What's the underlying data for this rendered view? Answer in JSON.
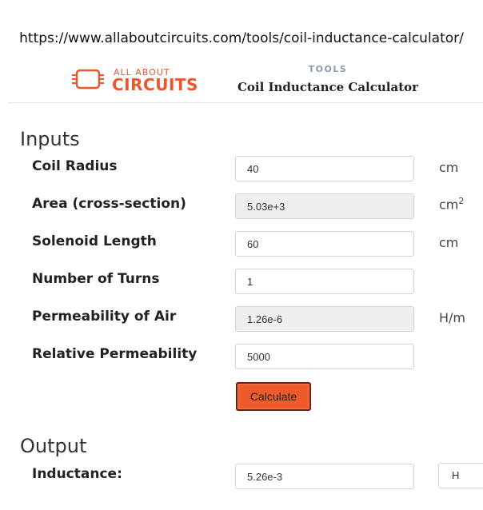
{
  "url": "https://www.allaboutcircuits.com/tools/coil-inductance-calculator/",
  "brand": {
    "small_text": "ALL ABOUT",
    "big_text": "CIRCUITS",
    "color": "#e8582a"
  },
  "header": {
    "section": "TOOLS",
    "title": "Coil Inductance Calculator"
  },
  "inputs": {
    "heading": "Inputs",
    "rows": [
      {
        "label": "Coil Radius",
        "value": "40",
        "unit": "cm",
        "readonly": false
      },
      {
        "label": "Area (cross-section)",
        "value": "5.03e+3",
        "unit": "cm",
        "unit_sup": "2",
        "readonly": true
      },
      {
        "label": "Solenoid Length",
        "value": "60",
        "unit": "cm",
        "readonly": false
      },
      {
        "label": "Number of Turns",
        "value": "1",
        "unit": "",
        "readonly": false
      },
      {
        "label": "Permeability of Air",
        "value": "1.26e-6",
        "unit": "H/m",
        "readonly": true
      },
      {
        "label": "Relative Permeability",
        "value": "5000",
        "unit": "",
        "readonly": false
      }
    ],
    "calculate_label": "Calculate",
    "button_color": "#ef5a2a"
  },
  "output": {
    "heading": "Output",
    "label": "Inductance:",
    "value": "5.26e-3",
    "unit_select": "H"
  }
}
